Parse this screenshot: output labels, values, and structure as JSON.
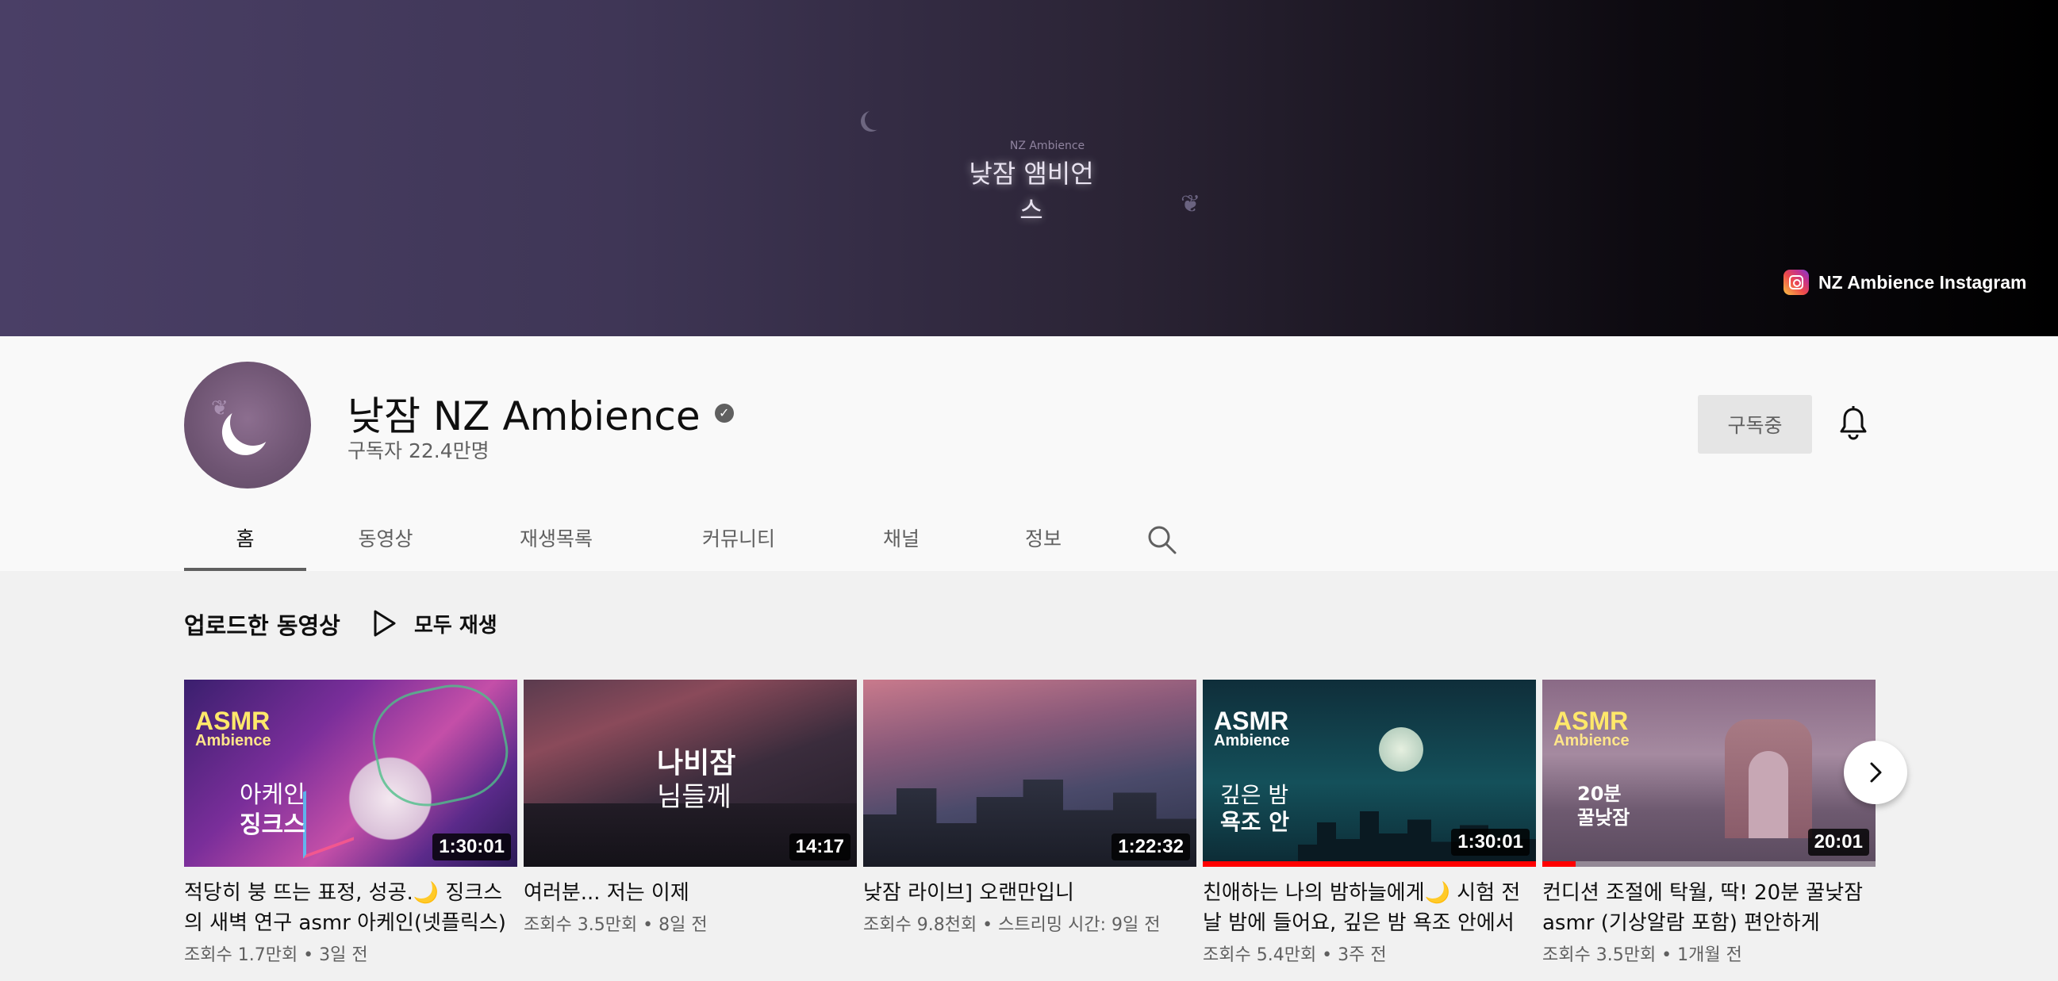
{
  "banner": {
    "small_text": "NZ Ambience",
    "title": "낮잠 앰비언스",
    "link_label": "NZ Ambience Instagram"
  },
  "channel": {
    "name": "낮잠 NZ Ambience",
    "verified_mark": "✓",
    "subscribers": "구독자 22.4만명",
    "subscribe_label": "구독중"
  },
  "tabs": [
    {
      "label": "홈",
      "active": true
    },
    {
      "label": "동영상"
    },
    {
      "label": "재생목록"
    },
    {
      "label": "커뮤니티"
    },
    {
      "label": "채널"
    },
    {
      "label": "정보"
    }
  ],
  "shelf": {
    "title": "업로드한 동영상",
    "play_all": "모두 재생"
  },
  "videos": [
    {
      "title": "적당히 붕 뜨는 표정, 성공.🌙 징크스의 새벽 연구 asmr 아케인(넷플릭스)",
      "meta": "조회수 1.7만회 • 3일 전",
      "duration": "1:30:01",
      "thumb_text_1": "아케인",
      "thumb_text_2": "징크스",
      "asmr": "ASMR",
      "ambience": "Ambience"
    },
    {
      "title": "여러분... 저는 이제",
      "meta": "조회수 3.5만회 • 8일 전",
      "duration": "14:17",
      "thumb_text_1": "나비잠",
      "thumb_text_2": "님들께"
    },
    {
      "title": "낮잠 라이브] 오랜만입니",
      "meta": "조회수 9.8천회 • 스트리밍 시간: 9일 전",
      "duration": "1:22:32"
    },
    {
      "title": "친애하는 나의 밤하늘에게🌙 시험 전날 밤에 들어요, 깊은 밤 욕조 안에서",
      "meta": "조회수 5.4만회 • 3주 전",
      "duration": "1:30:01",
      "progress": 1.0,
      "thumb_text_1": "깊은 밤",
      "thumb_text_2": "욕조 안",
      "asmr": "ASMR",
      "ambience": "Ambience"
    },
    {
      "title": "컨디션 조절에 탁월, 딱! 20분 꿀낮잠 asmr (기상알람 포함) 편안하게",
      "meta": "조회수 3.5만회 • 1개월 전",
      "duration": "20:01",
      "progress": 0.1,
      "thumb_text_1": "20분",
      "thumb_text_2": "꿀낮잠",
      "asmr": "ASMR",
      "ambience": "Ambience"
    }
  ],
  "colors": {
    "accent_red": "#ff0000",
    "text_primary": "#0f0f0f",
    "text_secondary": "#606060"
  }
}
